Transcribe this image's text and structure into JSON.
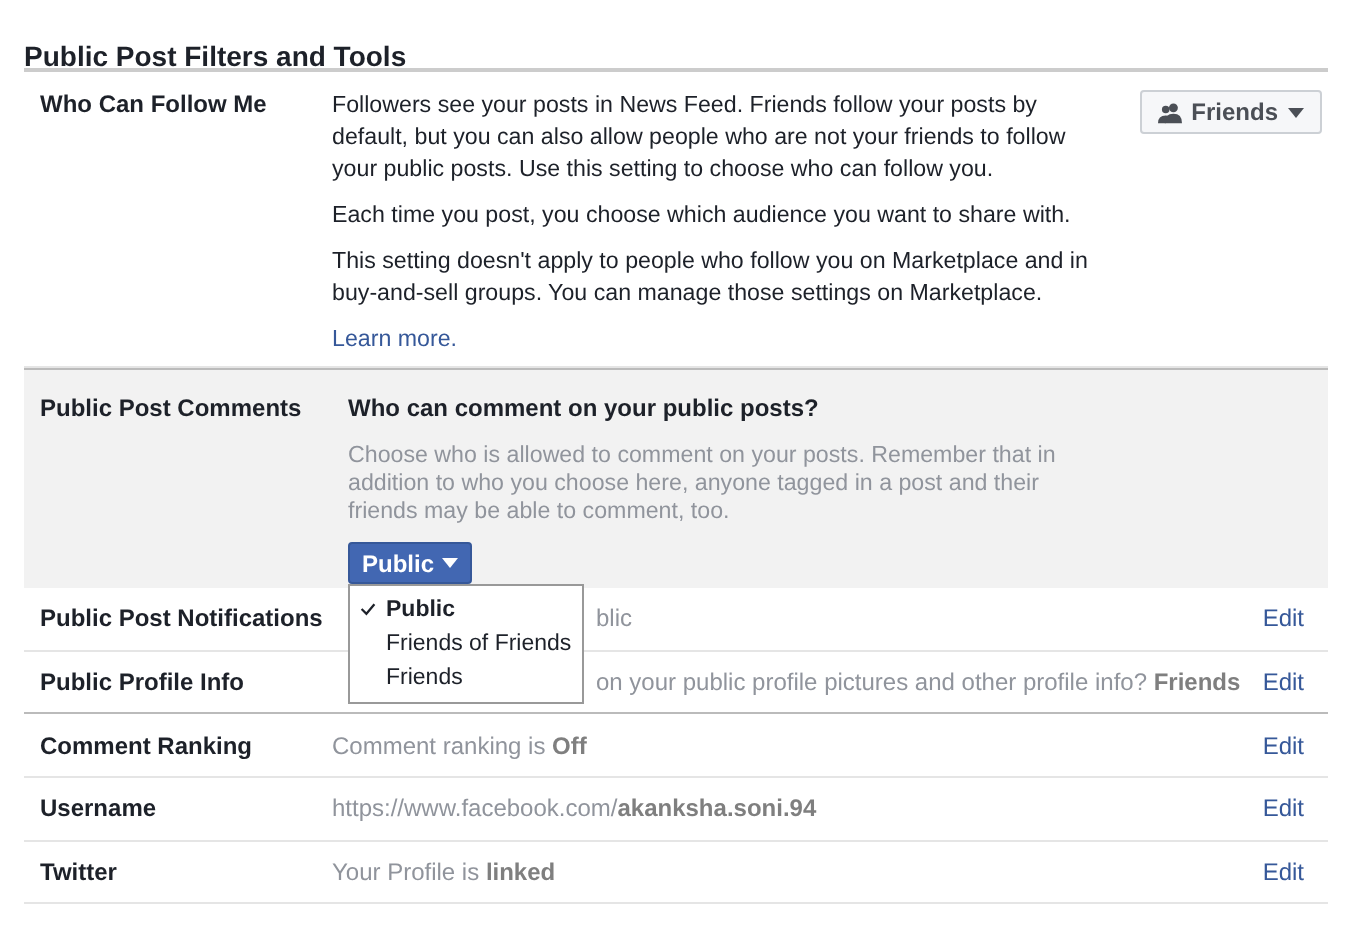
{
  "title": "Public Post Filters and Tools",
  "follow": {
    "label": "Who Can Follow Me",
    "paragraphs": [
      "Followers see your posts in News Feed. Friends follow your posts by default, but you can also allow people who are not your friends to follow your public posts. Use this setting to choose who can follow you.",
      "Each time you post, you choose which audience you want to share with.",
      "This setting doesn't apply to people who follow you on Marketplace and in buy-and-sell groups. You can manage those settings on Marketplace."
    ],
    "link": "Learn more.",
    "audience_button": "Friends"
  },
  "comments": {
    "label": "Public Post Comments",
    "question": "Who can comment on your public posts?",
    "help": "Choose who is allowed to comment on your posts. Remember that in addition to who you choose here, anyone tagged in a post and their friends may be able to comment, too.",
    "select_button": "Public",
    "menu": [
      {
        "label": "Public",
        "selected": true
      },
      {
        "label": "Friends of Friends",
        "selected": false
      },
      {
        "label": "Friends",
        "selected": false
      }
    ]
  },
  "rows": [
    {
      "label": "Public Post Notifications",
      "value": "blic",
      "covered": true,
      "action": "Edit"
    },
    {
      "label": "Public Profile Info",
      "value": "on your public profile pictures and other profile info? **Friends**",
      "covered": true,
      "action": "Edit"
    },
    {
      "label": "Comment Ranking",
      "value": "Comment ranking is **Off**",
      "covered": false,
      "action": "Edit"
    },
    {
      "label": "Username",
      "value": "https://www.facebook.com/**akanksha.soni.94**",
      "covered": false,
      "action": "Edit"
    },
    {
      "label": "Twitter",
      "value": "Your Profile is **linked**",
      "covered": false,
      "action": "Edit"
    }
  ]
}
